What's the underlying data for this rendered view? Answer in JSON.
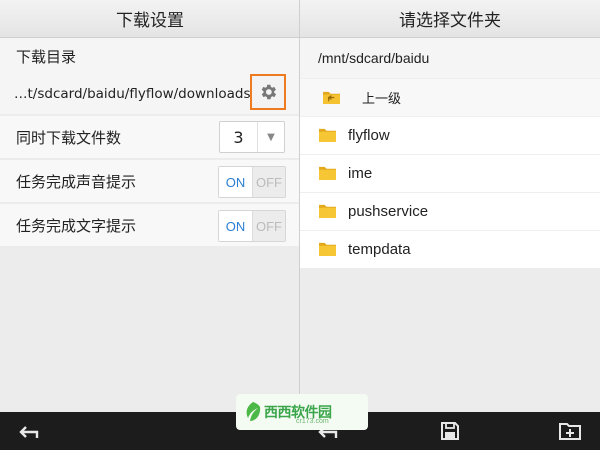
{
  "left_panel": {
    "title": "下载设置",
    "download_dir_label": "下载目录",
    "download_dir_path": "…t/sdcard/baidu/flyflow/downloads/",
    "concurrent_label": "同时下载文件数",
    "concurrent_value": "3",
    "sound_label": "任务完成声音提示",
    "text_label": "任务完成文字提示",
    "sound_toggle": {
      "on": "ON",
      "off": "OFF",
      "state": "on"
    },
    "text_toggle": {
      "on": "ON",
      "off": "OFF",
      "state": "on"
    }
  },
  "right_panel": {
    "title": "请选择文件夹",
    "current_path": "/mnt/sdcard/baidu",
    "up_label": "上一级",
    "folders": [
      "flyflow",
      "ime",
      "pushservice",
      "tempdata"
    ]
  },
  "bottom_bar": {
    "icons": [
      "back-icon",
      "back-icon",
      "save-icon",
      "new-folder-icon"
    ]
  },
  "watermark": {
    "text": "西西软件园",
    "sub": "cr173.com"
  },
  "colors": {
    "accent_orange": "#f07a1e",
    "toggle_on_blue": "#2a7fd4",
    "folder_yellow": "#f5c231",
    "bottom_bar": "#1c1c1c"
  }
}
